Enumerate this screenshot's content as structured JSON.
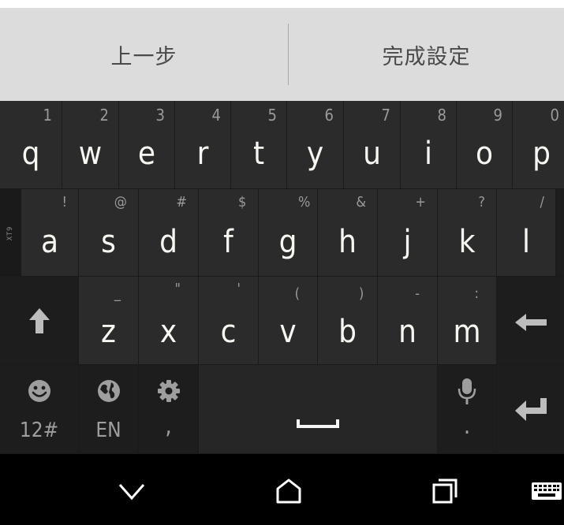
{
  "action_bar": {
    "back_label": "上一步",
    "finish_label": "完成設定"
  },
  "keyboard": {
    "mode_indicator": "XT9",
    "row1": [
      {
        "key": "q",
        "hint": "1"
      },
      {
        "key": "w",
        "hint": "2"
      },
      {
        "key": "e",
        "hint": "3"
      },
      {
        "key": "r",
        "hint": "4"
      },
      {
        "key": "t",
        "hint": "5"
      },
      {
        "key": "y",
        "hint": "6"
      },
      {
        "key": "u",
        "hint": "7"
      },
      {
        "key": "i",
        "hint": "8"
      },
      {
        "key": "o",
        "hint": "9"
      },
      {
        "key": "p",
        "hint": "0"
      }
    ],
    "row2": [
      {
        "key": "a",
        "hint": "!"
      },
      {
        "key": "s",
        "hint": "@"
      },
      {
        "key": "d",
        "hint": "#"
      },
      {
        "key": "f",
        "hint": "$"
      },
      {
        "key": "g",
        "hint": "%"
      },
      {
        "key": "h",
        "hint": "&"
      },
      {
        "key": "j",
        "hint": "+"
      },
      {
        "key": "k",
        "hint": "?"
      },
      {
        "key": "l",
        "hint": "/"
      }
    ],
    "row3": [
      {
        "key": "z",
        "hint": "_"
      },
      {
        "key": "x",
        "hint": "\""
      },
      {
        "key": "c",
        "hint": "'"
      },
      {
        "key": "v",
        "hint": "("
      },
      {
        "key": "b",
        "hint": ")"
      },
      {
        "key": "n",
        "hint": "-"
      },
      {
        "key": "m",
        "hint": ":"
      }
    ],
    "row4": {
      "symbols_label": "12#",
      "language_label": "EN",
      "settings_label": ",",
      "mic_label": "."
    },
    "icons": {
      "shift": "shift-arrow-up-icon",
      "backspace": "backspace-arrow-left-icon",
      "emoji": "smiley-icon",
      "language": "globe-icon",
      "settings": "gear-icon",
      "space": "space-bar-icon",
      "mic": "microphone-icon",
      "enter": "enter-return-icon"
    }
  },
  "nav_bar": {
    "icons": [
      "back-chevron-icon",
      "home-icon",
      "recents-icon",
      "keyboard-switch-icon"
    ]
  }
}
